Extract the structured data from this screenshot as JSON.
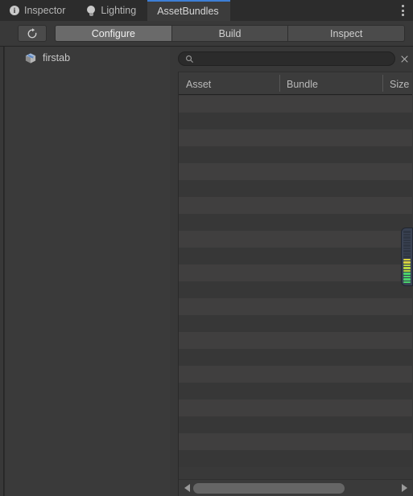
{
  "window": {
    "title": "AssetBundles",
    "menu_icon": "kebab-menu-icon"
  },
  "tabs": [
    {
      "label": "Inspector",
      "icon": "info-icon",
      "active": false
    },
    {
      "label": "Lighting",
      "icon": "bulb-icon",
      "active": false
    },
    {
      "label": "AssetBundles",
      "icon": "none",
      "active": true
    }
  ],
  "toolbar": {
    "refresh_icon": "refresh-icon",
    "refresh_label": "",
    "modes": [
      {
        "label": "Configure",
        "selected": true
      },
      {
        "label": "Build",
        "selected": false
      },
      {
        "label": "Inspect",
        "selected": false
      }
    ]
  },
  "bundle_tree": {
    "items": [
      {
        "label": "firstab",
        "icon": "asset-bundle-cube-icon"
      }
    ]
  },
  "search": {
    "value": "",
    "placeholder": "",
    "icon": "search-icon",
    "clear_icon": "close-icon"
  },
  "asset_table": {
    "columns": [
      {
        "key": "asset",
        "label": "Asset"
      },
      {
        "key": "bundle",
        "label": "Bundle"
      },
      {
        "key": "size",
        "label": "Size"
      }
    ],
    "rows": [],
    "empty_row_count": 22
  },
  "scrollbars": {
    "horizontal": {
      "left_arrow": "triangle-left-icon",
      "right_arrow": "triangle-right-icon",
      "thumb_fraction": 0.74
    }
  },
  "level_meter": {
    "name": "audio-level-meter",
    "segment_count": 19,
    "lit_count": 9,
    "colors": {
      "low": "#4ad36a",
      "mid": "#b7d83f",
      "high": "#d8d13f",
      "off": "#2f3643"
    }
  },
  "colors": {
    "window_bg": "#383838",
    "tabbar_bg": "#2c2c2c",
    "active_tab_bg": "#3c3c3c",
    "active_tab_accent": "#3d7fd6",
    "button_bg": "#4b4b4b",
    "button_selected_bg": "#6a6a6a",
    "row_even": "#403f3f",
    "row_odd": "#373737",
    "text": "#c4c4c4"
  }
}
